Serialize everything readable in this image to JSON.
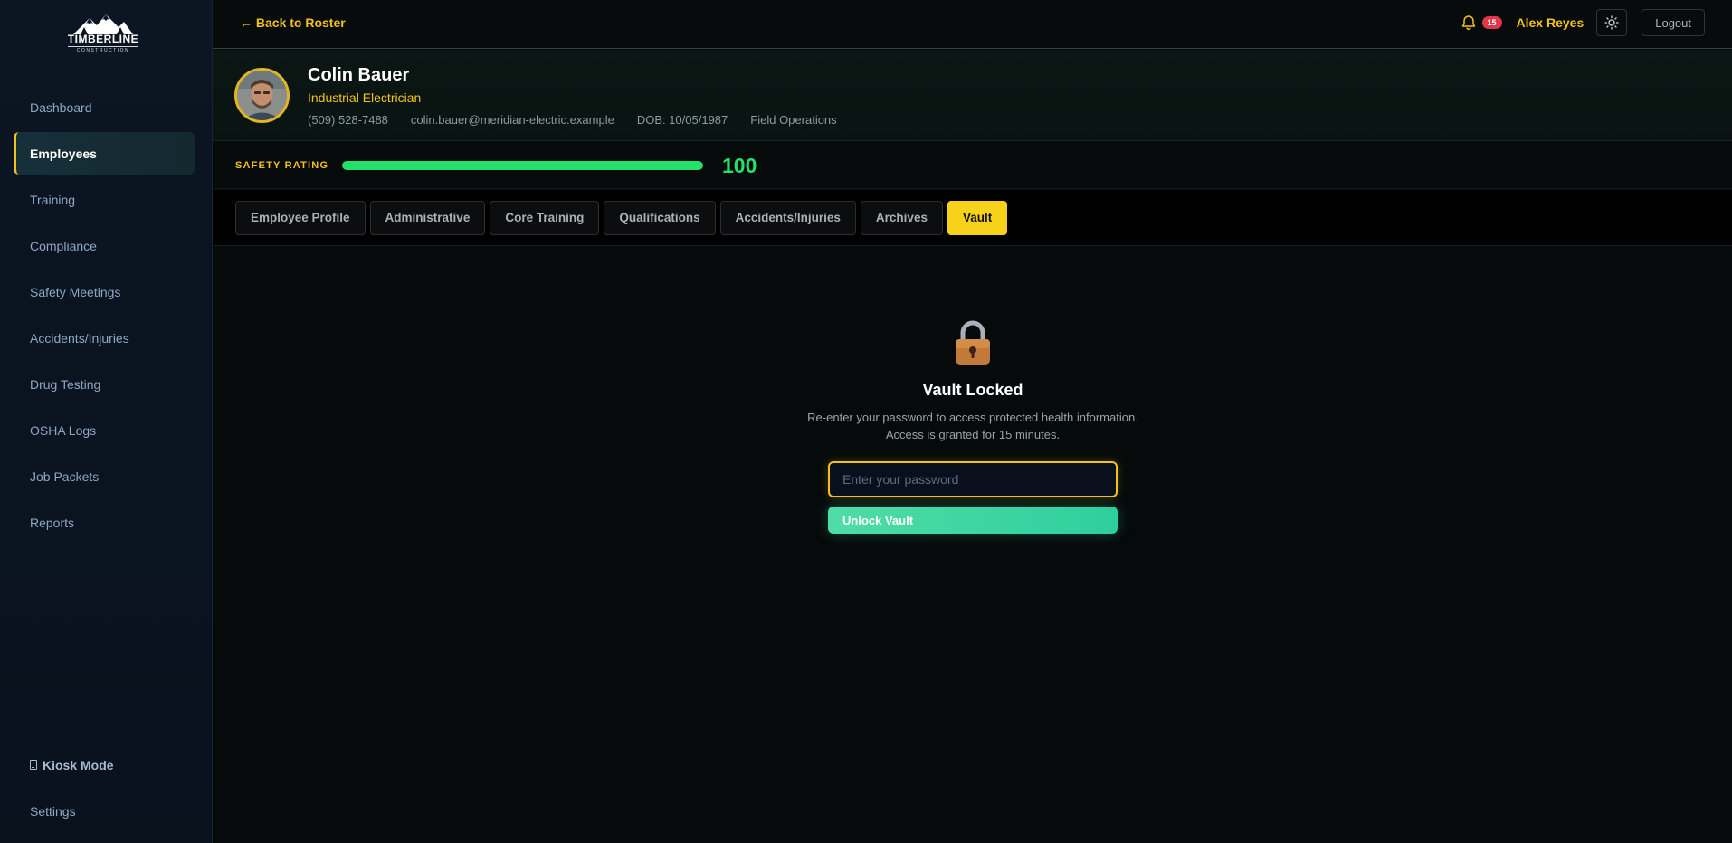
{
  "brand": {
    "name": "TIMBERLINE",
    "tagline": "CONSTRUCTION"
  },
  "sidebar": {
    "items": [
      {
        "label": "Dashboard"
      },
      {
        "label": "Employees",
        "active": true
      },
      {
        "label": "Training"
      },
      {
        "label": "Compliance"
      },
      {
        "label": "Safety Meetings"
      },
      {
        "label": "Accidents/Injuries"
      },
      {
        "label": "Drug Testing"
      },
      {
        "label": "OSHA Logs"
      },
      {
        "label": "Job Packets"
      },
      {
        "label": "Reports"
      }
    ],
    "kiosk_label": "Kiosk Mode",
    "settings_label": "Settings"
  },
  "topbar": {
    "back_label": "← Back to Roster",
    "notification_count": "15",
    "user_name": "Alex Reyes",
    "logout_label": "Logout"
  },
  "employee": {
    "name": "Colin Bauer",
    "title": "Industrial Electrician",
    "phone": "(509) 528-7488",
    "email": "colin.bauer@meridian-electric.example",
    "dob": "DOB: 10/05/1987",
    "department": "Field Operations"
  },
  "safety": {
    "label": "SAFETY RATING",
    "value": "100",
    "percent": 100,
    "color": "#22e06a"
  },
  "tabs": [
    {
      "label": "Employee Profile"
    },
    {
      "label": "Administrative"
    },
    {
      "label": "Core Training"
    },
    {
      "label": "Qualifications"
    },
    {
      "label": "Accidents/Injuries"
    },
    {
      "label": "Archives"
    },
    {
      "label": "Vault",
      "active": true
    }
  ],
  "vault": {
    "icon": "lock-icon",
    "title": "Vault Locked",
    "desc_line1": "Re-enter your password to access protected health information.",
    "desc_line2": "Access is granted for 15 minutes.",
    "password_placeholder": "Enter your password",
    "password_value": "",
    "unlock_label": "Unlock Vault"
  },
  "colors": {
    "accent": "#f2c21b",
    "success": "#22e06a",
    "unlock": "#2ecf9c",
    "badge": "#e2364a"
  }
}
